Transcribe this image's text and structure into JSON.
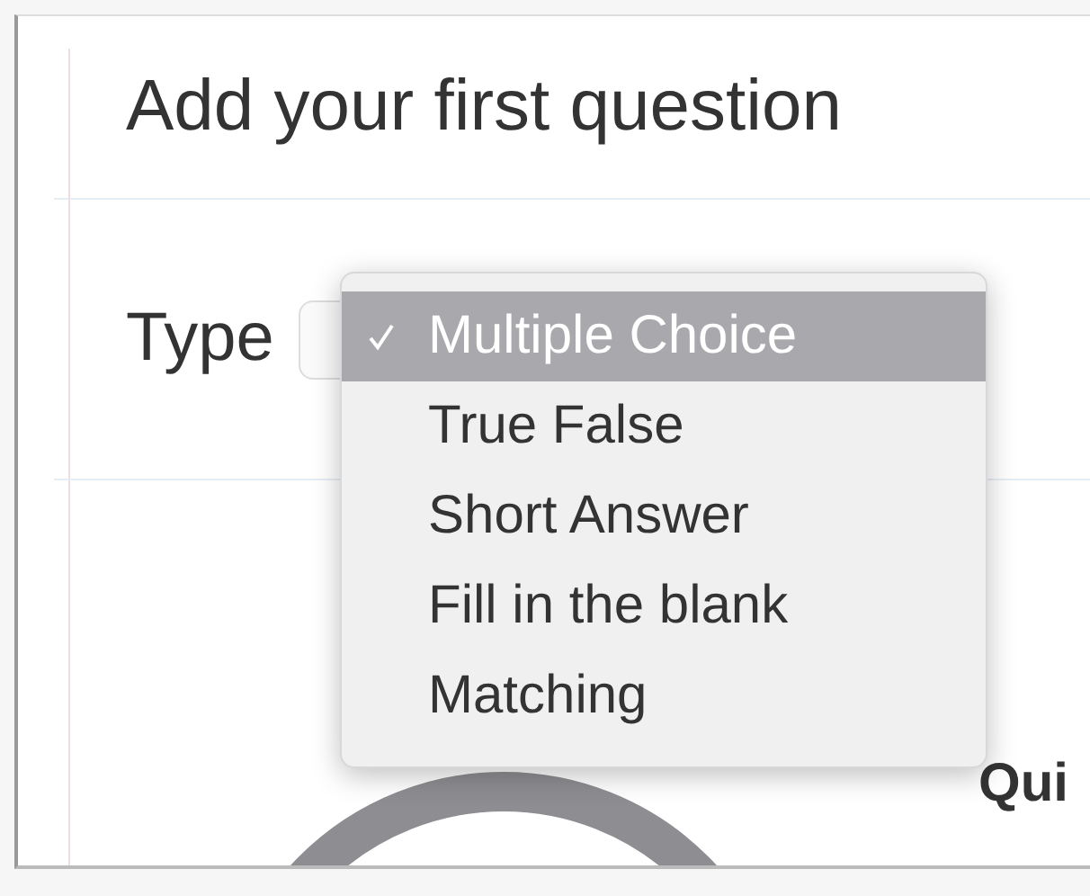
{
  "heading": "Add your first question",
  "type_field": {
    "label": "Type"
  },
  "type_menu": {
    "options": [
      {
        "label": "Multiple Choice",
        "selected": true
      },
      {
        "label": "True False",
        "selected": false
      },
      {
        "label": "Short Answer",
        "selected": false
      },
      {
        "label": "Fill in the blank",
        "selected": false
      },
      {
        "label": "Matching",
        "selected": false
      }
    ]
  },
  "side_heading": "Qui"
}
